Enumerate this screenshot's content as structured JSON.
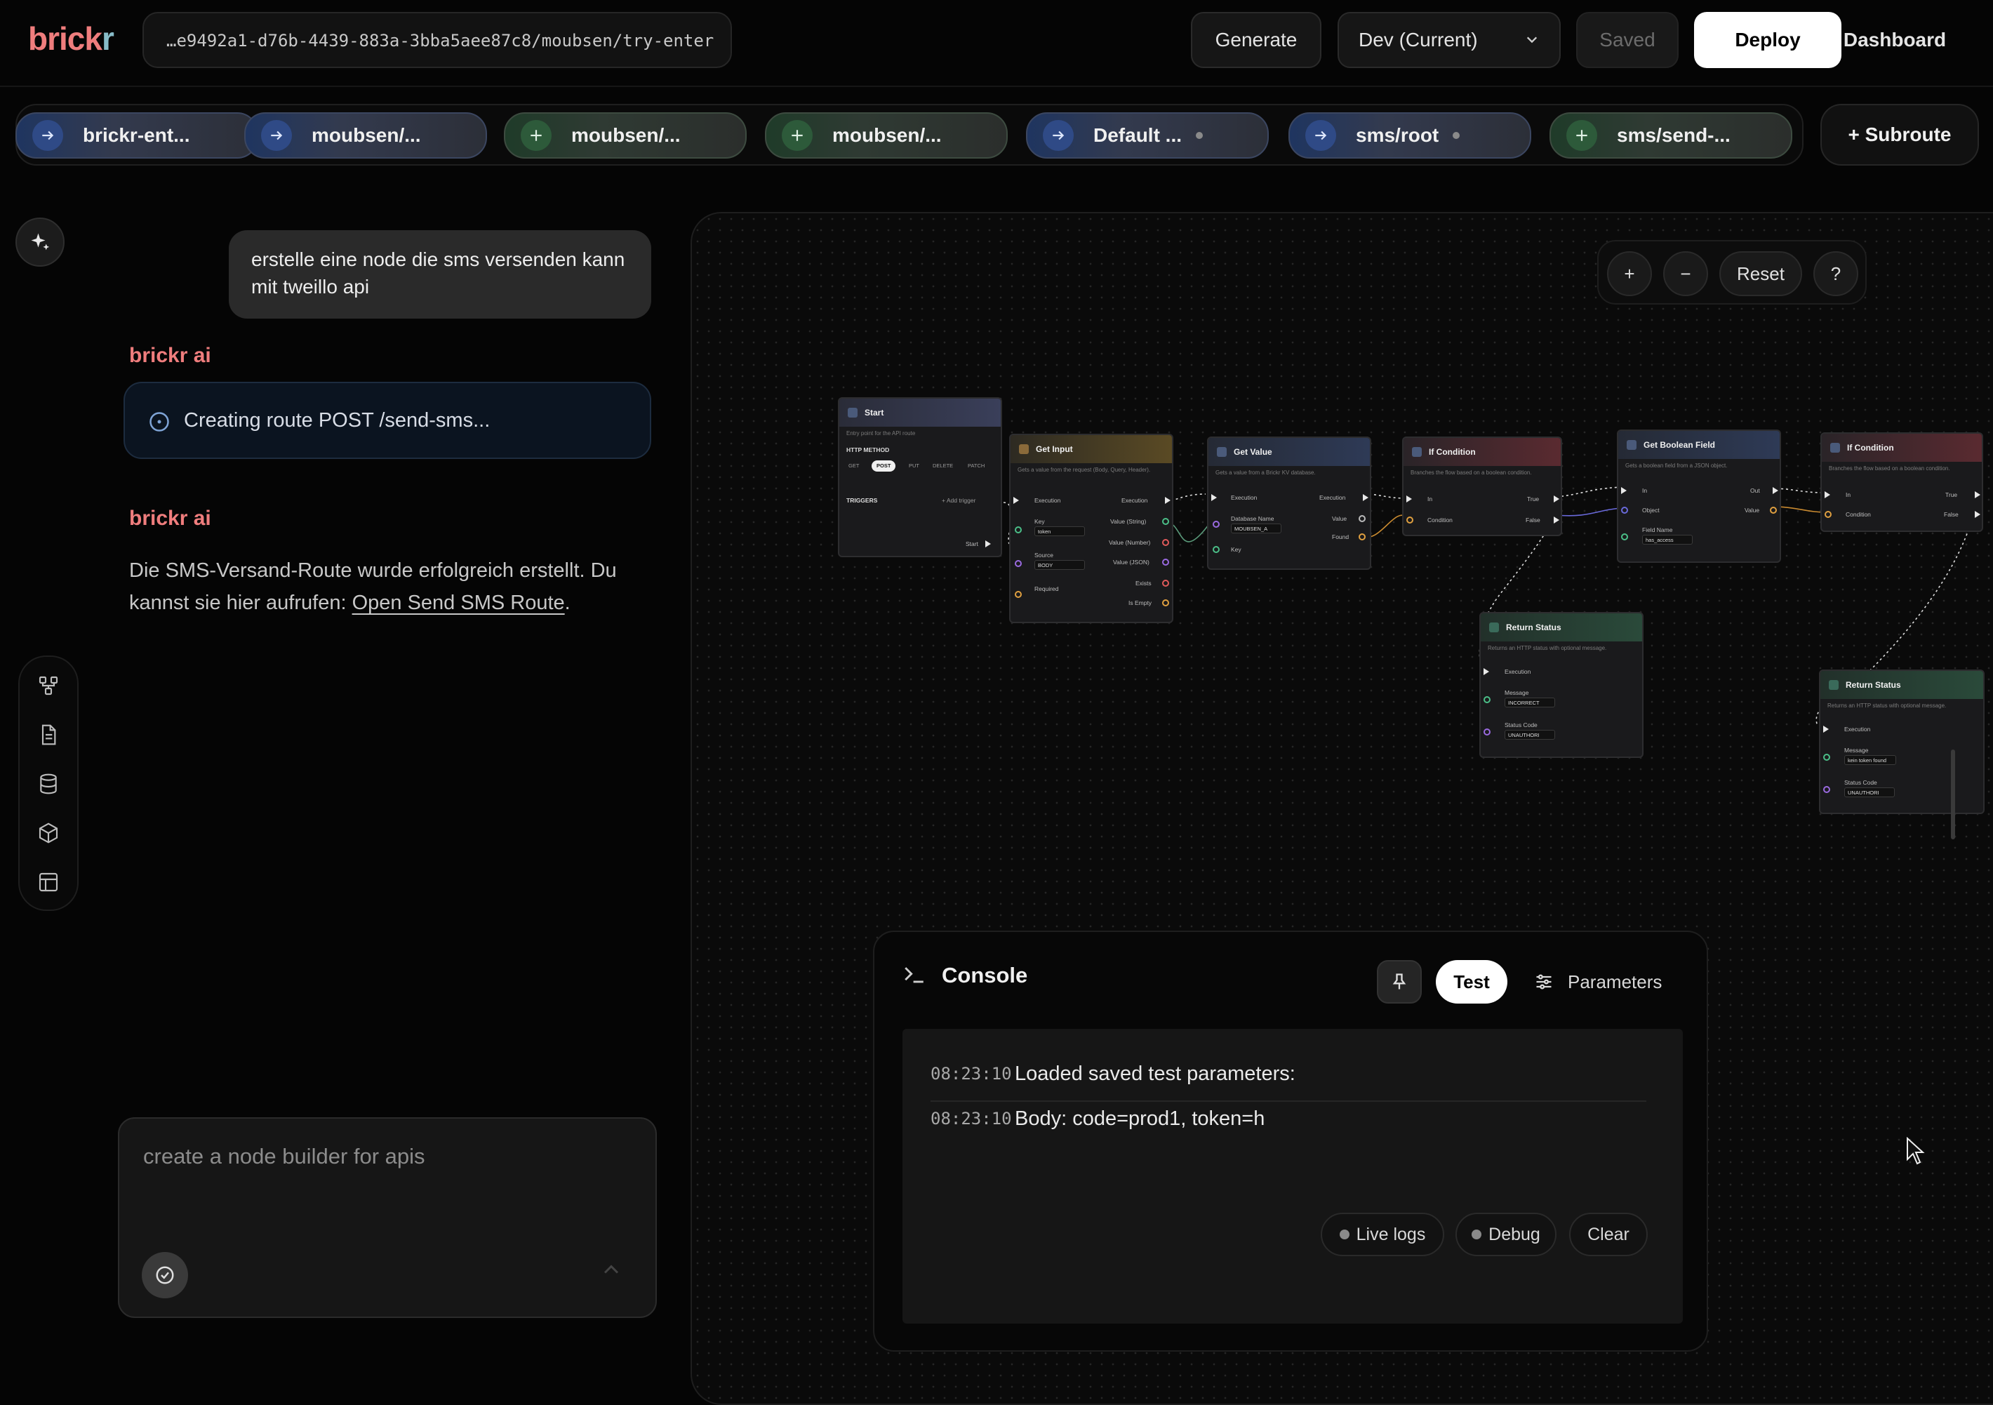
{
  "header": {
    "logo_part1": "brick",
    "logo_part2": "r",
    "url_path": "…e9492a1-d76b-4439-883a-3bba5aee87c8/moubsen/try-enter",
    "generate_label": "Generate",
    "environment": "Dev (Current)",
    "saved_label": "Saved",
    "deploy_label": "Deploy",
    "dashboard_label": "Dashboard"
  },
  "tabs": [
    {
      "label": "brickr-ent...",
      "icon": "arrow-right-icon",
      "kind": "route",
      "unsaved": false
    },
    {
      "label": "moubsen/...",
      "icon": "arrow-right-icon",
      "kind": "route",
      "unsaved": false
    },
    {
      "label": "moubsen/...",
      "icon": "plus-icon",
      "kind": "subroute",
      "unsaved": false
    },
    {
      "label": "moubsen/...",
      "icon": "plus-icon",
      "kind": "subroute",
      "unsaved": false
    },
    {
      "label": "Default ...",
      "icon": "arrow-right-icon",
      "kind": "route",
      "unsaved": true
    },
    {
      "label": "sms/root",
      "icon": "arrow-right-icon",
      "kind": "route",
      "unsaved": true
    },
    {
      "label": "sms/send-...",
      "icon": "plus-icon",
      "kind": "subroute",
      "unsaved": false
    }
  ],
  "subroute_label": "+ Subroute",
  "chat": {
    "user_message": "erstelle eine node die sms versenden kann mit tweillo api",
    "assistant_name": "brickr ai",
    "status_text": "Creating route POST /send-sms...",
    "assistant_text": "Die SMS-Versand-Route wurde erfolgreich erstellt. Du kannst sie hier aufrufen: ",
    "assistant_link": "Open Send SMS Route",
    "assistant_text_end": ".",
    "input_placeholder": "create a node builder for apis"
  },
  "sidebar_tools": [
    "nodes-icon",
    "document-icon",
    "database-icon",
    "package-icon",
    "layout-icon"
  ],
  "canvas": {
    "zoom_in": "+",
    "zoom_out": "−",
    "reset": "Reset",
    "help": "?",
    "nodes": {
      "start": {
        "title": "Start",
        "desc": "Entry point for the API route",
        "method_label": "HTTP METHOD",
        "methods": [
          "GET",
          "POST",
          "PUT",
          "DELETE",
          "PATCH"
        ],
        "selected_method": "POST",
        "triggers_label": "TRIGGERS",
        "add_trigger": "+ Add trigger",
        "out": "Start"
      },
      "get_input": {
        "title": "Get Input",
        "desc": "Gets a value from the request (Body, Query, Header).",
        "exec_in": "Execution",
        "exec_out": "Execution",
        "key_label": "Key",
        "key_value": "token",
        "source_label": "Source",
        "source_value": "BODY",
        "required_label": "Required",
        "outputs": [
          "Value (String)",
          "Value (Number)",
          "Value (JSON)",
          "Exists",
          "Is Empty"
        ]
      },
      "get_value": {
        "title": "Get Value",
        "desc": "Gets a value from a Brickr KV database.",
        "exec_in": "Execution",
        "exec_out": "Execution",
        "db_label": "Database Name",
        "db_value": "MOUBSEN_A",
        "key_label": "Key",
        "outputs": [
          "Value",
          "Found"
        ]
      },
      "if_condition_1": {
        "title": "If Condition",
        "desc": "Branches the flow based on a boolean condition.",
        "in": "In",
        "condition": "Condition",
        "outputs": [
          "True",
          "False"
        ]
      },
      "get_bool": {
        "title": "Get Boolean Field",
        "desc": "Gets a boolean field from a JSON object.",
        "in": "In",
        "object": "Object",
        "field_label": "Field Name",
        "field_value": "has_access",
        "outputs": [
          "Out",
          "Value"
        ]
      },
      "if_condition_2": {
        "title": "If Condition",
        "desc": "Branches the flow based on a boolean condition.",
        "in": "In",
        "condition": "Condition",
        "outputs": [
          "True",
          "False"
        ]
      },
      "return_1": {
        "title": "Return Status",
        "desc": "Returns an HTTP status with optional message.",
        "exec": "Execution",
        "message_label": "Message",
        "message_value": "INCORRECT",
        "code_label": "Status Code",
        "code_value": "UNAUTHORI"
      },
      "return_2": {
        "title": "Return Status",
        "desc": "Returns an HTTP status with optional message.",
        "exec": "Execution",
        "message_label": "Message",
        "message_value": "kein token found",
        "code_label": "Status Code",
        "code_value": "UNAUTHORI"
      }
    }
  },
  "console": {
    "title": "Console",
    "test_label": "Test",
    "parameters_label": "Parameters",
    "logs": [
      {
        "time": "08:23:10",
        "message": "Loaded saved test parameters:"
      },
      {
        "time": "08:23:10",
        "message": "Body: code=prod1, token=h"
      }
    ],
    "live_logs_label": "Live logs",
    "debug_label": "Debug",
    "clear_label": "Clear"
  },
  "colors": {
    "accent_red": "#ef7d7d",
    "accent_teal": "#88bcc8",
    "route_blue": "#2f4a86",
    "subroute_green": "#2d5a3a"
  }
}
